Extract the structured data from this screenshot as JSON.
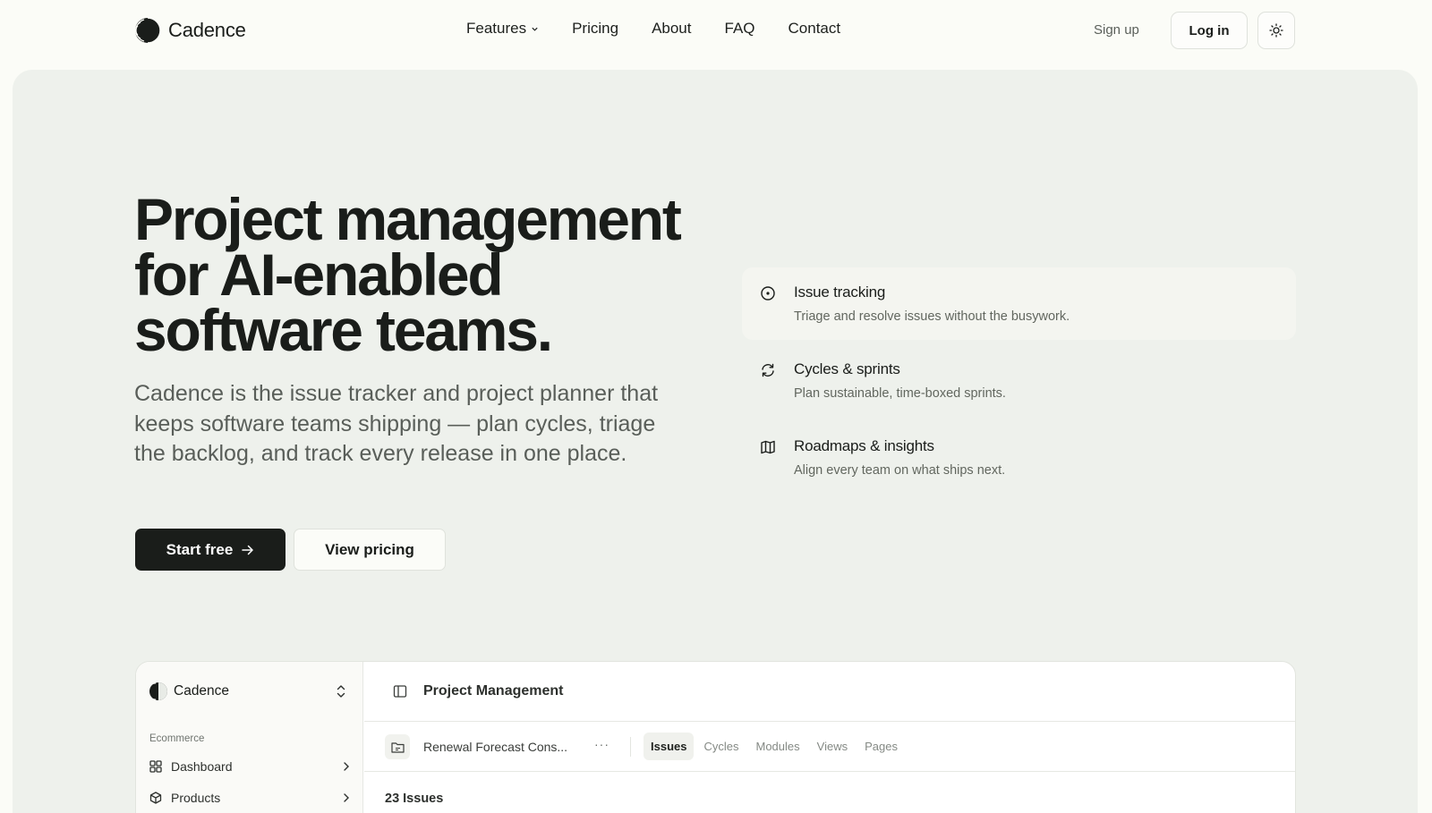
{
  "brand": {
    "name": "Cadence"
  },
  "nav": {
    "links": [
      "Features",
      "Pricing",
      "About",
      "FAQ",
      "Contact"
    ],
    "signup": "Sign up",
    "login": "Log in"
  },
  "hero": {
    "headline": "Project management for AI-enabled software teams.",
    "subcopy": "Cadence is the issue tracker and project planner that keeps software teams shipping — plan cycles, triage the backlog, and track every release in one place.",
    "primary_cta": "Start free",
    "secondary_cta": "View pricing"
  },
  "features": [
    {
      "title": "Issue tracking",
      "desc": "Triage and resolve issues without the busywork.",
      "icon": "circle-dot-icon"
    },
    {
      "title": "Cycles & sprints",
      "desc": "Plan sustainable, time-boxed sprints.",
      "icon": "refresh-icon"
    },
    {
      "title": "Roadmaps & insights",
      "desc": "Align every team on what ships next.",
      "icon": "map-icon"
    }
  ],
  "app": {
    "workspace": "Cadence",
    "group": "Ecommerce",
    "sidebar": [
      {
        "label": "Dashboard",
        "icon": "grid-icon"
      },
      {
        "label": "Products",
        "icon": "box-icon"
      }
    ],
    "title": "Project Management",
    "project": "Renewal Forecast Cons...",
    "more": "···",
    "tabs": [
      "Issues",
      "Cycles",
      "Modules",
      "Views",
      "Pages"
    ],
    "active_tab": "Issues",
    "issue_count": "23 Issues"
  }
}
